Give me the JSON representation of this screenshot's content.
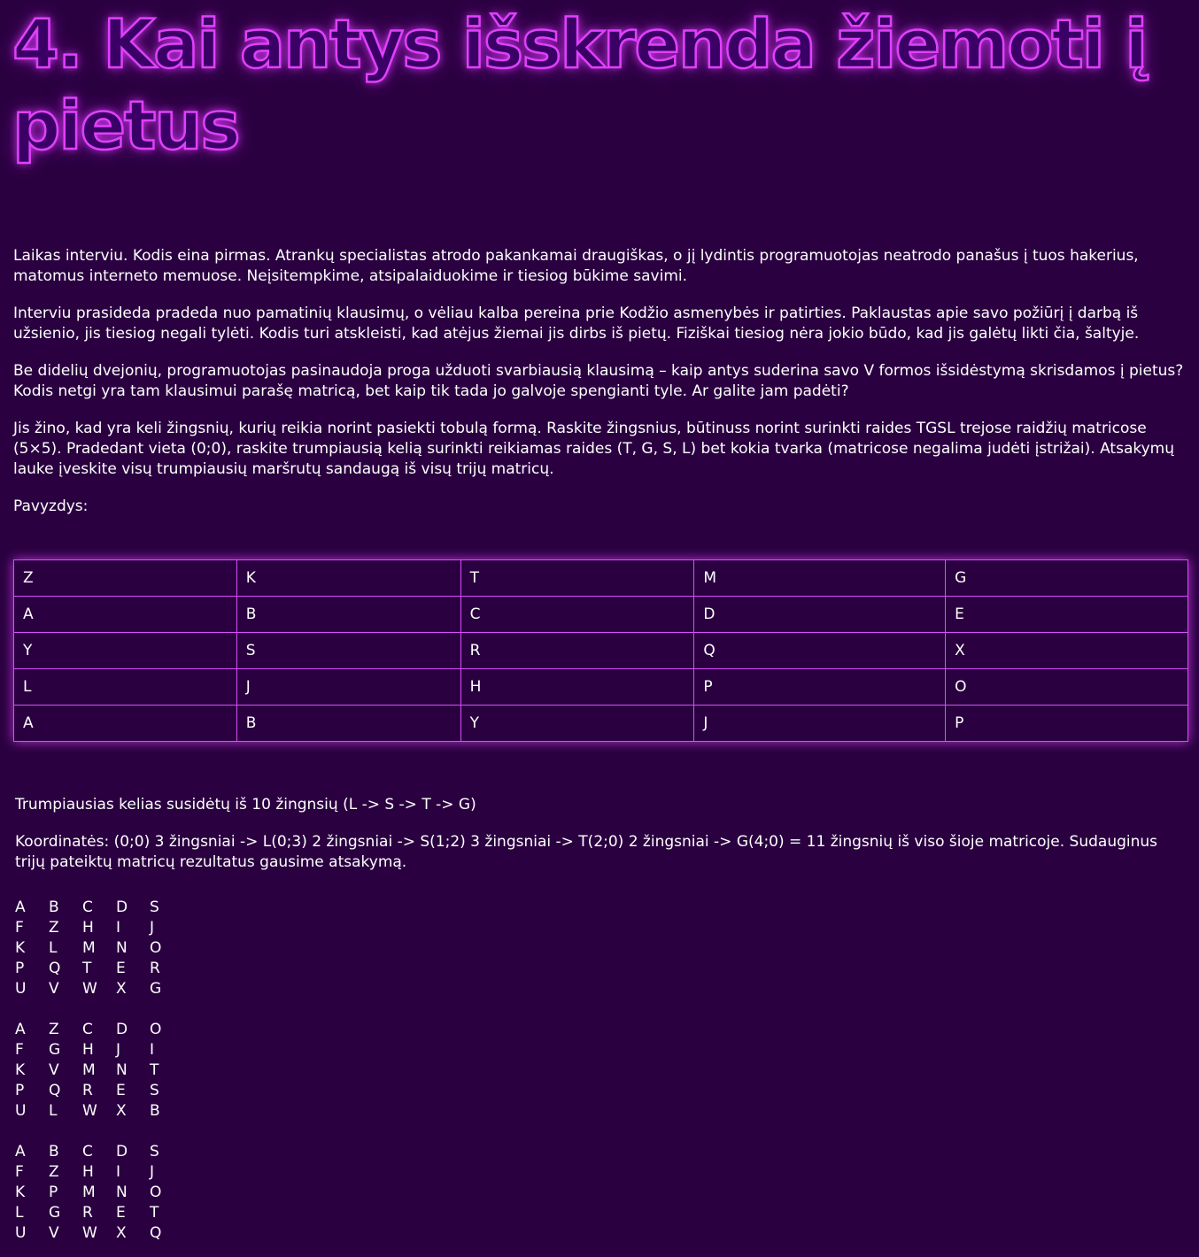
{
  "title": "4. Kai antys išskrenda žiemoti į pietus",
  "paragraphs": [
    "Laikas interviu. Kodis eina pirmas. Atrankų specialistas atrodo pakankamai draugiškas, o jį lydintis programuotojas neatrodo panašus į tuos hakerius, matomus interneto memuose. Neįsitempkime, atsipalaiduokime ir tiesiog būkime savimi.",
    "Interviu prasideda pradeda nuo pamatinių klausimų, o vėliau kalba pereina prie Kodžio asmenybės ir patirties. Paklaustas apie savo požiūrį į darbą iš užsienio, jis tiesiog negali tylėti. Kodis turi atskleisti, kad atėjus žiemai jis dirbs iš pietų. Fiziškai tiesiog nėra jokio būdo, kad jis galėtų likti čia, šaltyje.",
    "Be didelių dvejonių, programuotojas pasinaudoja proga užduoti svarbiausią klausimą – kaip antys suderina savo V formos išsidėstymą skrisdamos į pietus? Kodis netgi yra tam klausimui parašę matricą, bet kaip tik tada jo galvoje spengianti tyle. Ar galite jam padėti?",
    "Jis žino, kad yra keli žingsnių, kurių reikia norint pasiekti tobulą formą. Raskite žingsnius, būtinuss norint surinkti raides TGSL trejose raidžių matricose (5×5). Pradedant vieta (0;0), raskite trumpiausią kelią surinkti reikiamas raides (T, G, S, L) bet kokia tvarka (matricose negalima judėti įstrižai). Atsakymų lauke įveskite visų trumpiausių maršrutų sandaugą iš visų trijų matricų.",
    "Pavyzdys:"
  ],
  "example_table": [
    [
      "Z",
      "K",
      "T",
      "M",
      "G"
    ],
    [
      "A",
      "B",
      "C",
      "D",
      "E"
    ],
    [
      "Y",
      "S",
      "R",
      "Q",
      "X"
    ],
    [
      "L",
      "J",
      "H",
      "P",
      "O"
    ],
    [
      "A",
      "B",
      "Y",
      "J",
      "P"
    ]
  ],
  "explanation": [
    "Trumpiausias kelias susidėtų iš 10 žingnsių (L -> S -> T -> G)",
    "Koordinatės: (0;0) 3 žingsniai -> L(0;3) 2 žingsniai -> S(1;2) 3 žingsniai -> T(2;0) 2 žingsniai -> G(4;0) = 11 žingsnių iš viso šioje matricoje. Sudauginus trijų pateiktų matricų rezultatus gausime atsakymą."
  ],
  "matrices": [
    [
      [
        "A",
        "B",
        "C",
        "D",
        "S"
      ],
      [
        "F",
        "Z",
        "H",
        "I",
        "J"
      ],
      [
        "K",
        "L",
        "M",
        "N",
        "O"
      ],
      [
        "P",
        "Q",
        "T",
        "E",
        "R"
      ],
      [
        "U",
        "V",
        "W",
        "X",
        "G"
      ]
    ],
    [
      [
        "A",
        "Z",
        "C",
        "D",
        "O"
      ],
      [
        "F",
        "G",
        "H",
        "J",
        "I"
      ],
      [
        "K",
        "V",
        "M",
        "N",
        "T"
      ],
      [
        "P",
        "Q",
        "R",
        "E",
        "S"
      ],
      [
        "U",
        "L",
        "W",
        "X",
        "B"
      ]
    ],
    [
      [
        "A",
        "B",
        "C",
        "D",
        "S"
      ],
      [
        "F",
        "Z",
        "H",
        "I",
        "J"
      ],
      [
        "K",
        "P",
        "M",
        "N",
        "O"
      ],
      [
        "L",
        "G",
        "R",
        "E",
        "T"
      ],
      [
        "U",
        "V",
        "W",
        "X",
        "Q"
      ]
    ]
  ]
}
